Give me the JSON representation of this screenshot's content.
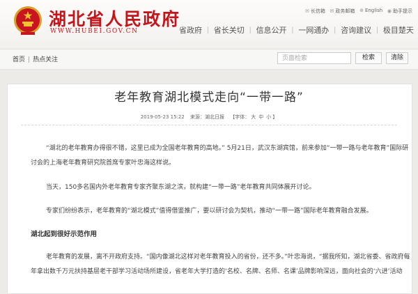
{
  "header": {
    "site_title": "湖北省人民政府",
    "site_domain": "WWW.HUBEI.GOV.CN",
    "utility": [
      {
        "label": "长信箱",
        "icon": "mail-icon"
      },
      {
        "label": "政务邮箱",
        "icon": "envelope-icon"
      },
      {
        "label": "English",
        "icon": "globe-icon"
      },
      {
        "label": "助手提示",
        "icon": "assist-icon"
      }
    ],
    "nav": [
      "省政府",
      "省长关切",
      "信息公开",
      "一网通办",
      "咨询建议",
      "极目楚天"
    ]
  },
  "breadcrumb": {
    "home": "首页",
    "current": "热点关注"
  },
  "search": {
    "placeholder": "页面检索",
    "search_label": "检索",
    "clear_label": "清除"
  },
  "article": {
    "title": "老年教育湖北模式走向“一带一路”",
    "meta": {
      "date": "2019-05-23 15:22",
      "source_label": "来源：",
      "source": "湖北日报",
      "font_label": "【字体：",
      "sizes": [
        "大",
        "中",
        "小"
      ],
      "font_end": "】"
    },
    "paragraphs": [
      {
        "lines": [
          "“湖北的老年教育办得很不错，这里已成为全国老年教育的高地。” 5月21日，武汉东湖宾馆，前来参加“一带一路与老年教育”国际研",
          "讨会的上海老年教育研究院首席专家叶忠海这样说。"
        ]
      },
      {
        "lines": [
          "当天，150多名国内外老年教育专家齐聚东湖之滨，就构建“一带一路”老年教育共同体展开讨论。"
        ]
      },
      {
        "lines": [
          "专家们纷纷表示，老年教育的“湖北模式”值得借鉴推广，要以研讨会为契机，推动“一带一路”国际老年教育融合发展。"
        ]
      }
    ],
    "subheading": "湖北起到很好示范作用",
    "last": {
      "lines": [
        "老年教育的发展，离不开政府支持。“国内像湖北这样对老年教育投入的省份，还不多。”叶忠海说，“据我所知，湖北省委、省政府每",
        "年拿出数千万元扶持基层老干部学习活动场所建设，省老年大学打造的‘名校、名牌、名师、名课’品牌影响深远，面向社会的‘六进’活动"
      ]
    }
  }
}
